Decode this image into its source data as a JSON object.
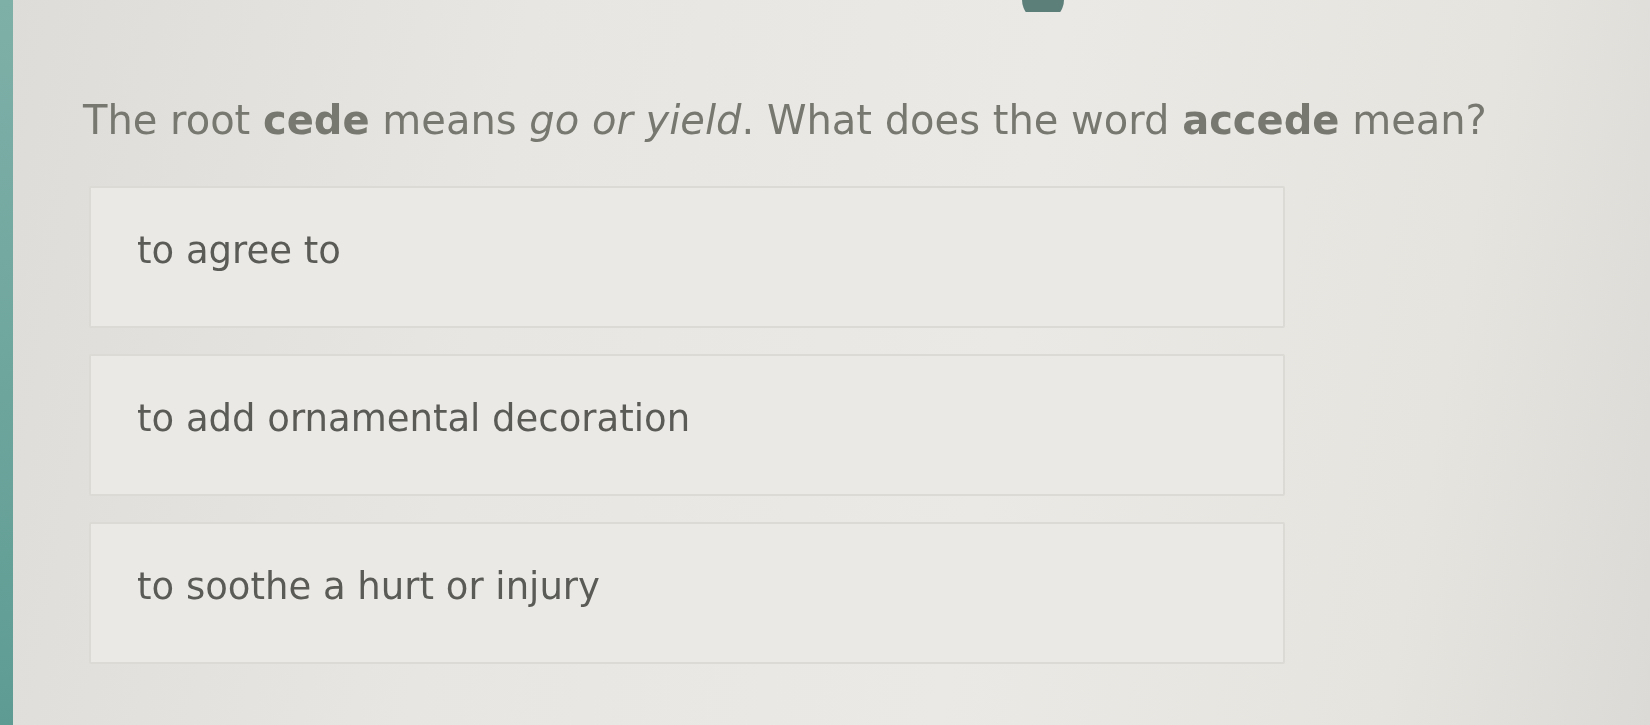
{
  "question": {
    "text": "The root **cede** means *go or yield*. What does the word **accede** mean?"
  },
  "options": [
    {
      "label": "to agree to"
    },
    {
      "label": "to add ornamental decoration"
    },
    {
      "label": "to soothe a hurt or injury"
    }
  ]
}
